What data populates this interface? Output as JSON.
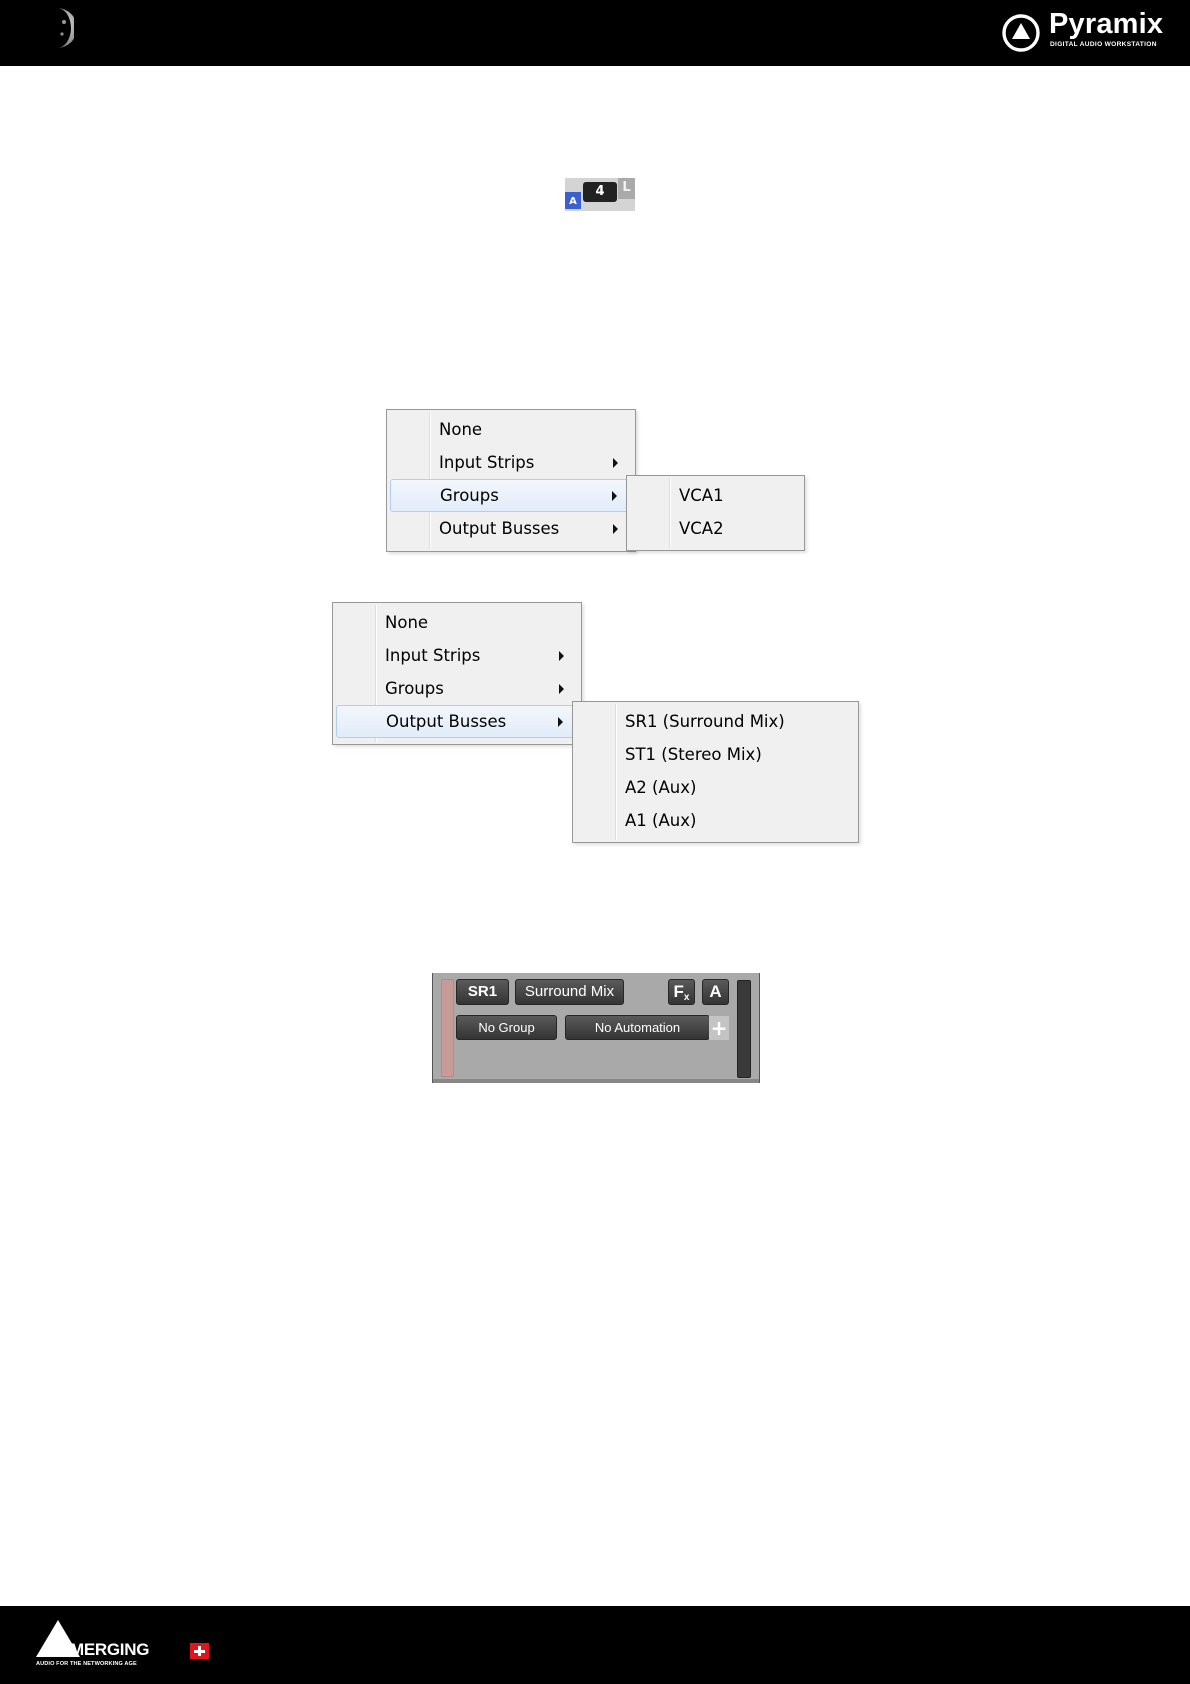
{
  "header": {
    "brand_title": "Pyramix",
    "brand_subtitle": "DIGITAL AUDIO WORKSTATION"
  },
  "mini_strip": {
    "automation_label": "A",
    "channel_number": "4",
    "side_label": "L",
    "automation_color": "#3c5fd2"
  },
  "menu_groups": {
    "items": [
      {
        "label": "None",
        "has_submenu": false
      },
      {
        "label": "Input Strips",
        "has_submenu": true
      },
      {
        "label": "Groups",
        "has_submenu": true,
        "highlighted": true
      },
      {
        "label": "Output Busses",
        "has_submenu": true
      }
    ],
    "submenu": [
      {
        "label": "VCA1"
      },
      {
        "label": "VCA2"
      }
    ]
  },
  "menu_busses": {
    "items": [
      {
        "label": "None",
        "has_submenu": false
      },
      {
        "label": "Input Strips",
        "has_submenu": true
      },
      {
        "label": "Groups",
        "has_submenu": true
      },
      {
        "label": "Output Busses",
        "has_submenu": true,
        "highlighted": true
      }
    ],
    "submenu": [
      {
        "label": "SR1 (Surround Mix)"
      },
      {
        "label": "ST1 (Stereo Mix)"
      },
      {
        "label": "A2 (Aux)"
      },
      {
        "label": "A1 (Aux)"
      }
    ]
  },
  "mixer_strip": {
    "bus_id": "SR1",
    "bus_name": "Surround Mix",
    "fx_label": "F",
    "fx_sub": "x",
    "auto_label": "A",
    "group_label": "No Group",
    "automation_label": "No Automation",
    "add_label": "+"
  },
  "footer": {
    "company_name": "MERGING",
    "tagline": "AUDIO FOR THE NETWORKING AGE"
  },
  "colors": {
    "bar_background": "#000000",
    "menu_highlight_border": "#b4cdee",
    "strip_background": "#a9a9a9"
  }
}
